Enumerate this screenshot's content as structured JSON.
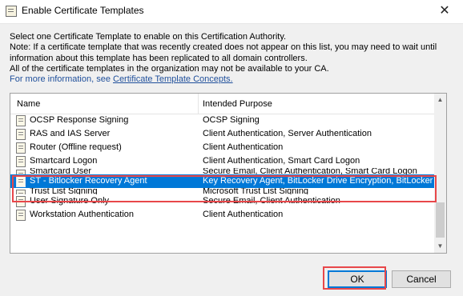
{
  "window": {
    "title": "Enable Certificate Templates",
    "close_glyph": "✕",
    "icon": "certificate-icon"
  },
  "intro": {
    "line1": "Select one Certificate Template to enable on this Certification Authority.",
    "line2": "Note: If a certificate template that was recently created does not appear on this list, you may need to wait until",
    "line3": "information about this template has been replicated to all domain controllers.",
    "line4": "All of the certificate templates in the organization may not be available to your CA.",
    "info_prefix": "For more information, see ",
    "info_link": "Certificate Template Concepts.",
    "info_color": "#1f4f9b"
  },
  "list": {
    "columns": {
      "name": "Name",
      "purpose": "Intended Purpose"
    },
    "rows": [
      {
        "name": "OCSP Response Signing",
        "purpose": "OCSP Signing"
      },
      {
        "name": "RAS and IAS Server",
        "purpose": "Client Authentication, Server Authentication"
      },
      {
        "name": "Router (Offline request)",
        "purpose": "Client Authentication"
      },
      {
        "name": "Smartcard Logon",
        "purpose": "Client Authentication, Smart Card Logon"
      },
      {
        "name": "Smartcard User",
        "purpose": "Secure Email, Client Authentication, Smart Card Logon"
      },
      {
        "name": "ST - Bitlocker Recovery Agent",
        "purpose": "Key Recovery Agent, BitLocker Drive Encryption, BitLocker D"
      },
      {
        "name": "Trust List Signing",
        "purpose": "Microsoft Trust List Signing"
      },
      {
        "name": "User Signature Only",
        "purpose": "Secure Email, Client Authentication"
      },
      {
        "name": "Workstation Authentication",
        "purpose": "Client Authentication"
      }
    ],
    "selected_index": 5,
    "selection_color": "#0078d7"
  },
  "buttons": {
    "ok": "OK",
    "cancel": "Cancel"
  },
  "highlight_color": "#e8474a"
}
